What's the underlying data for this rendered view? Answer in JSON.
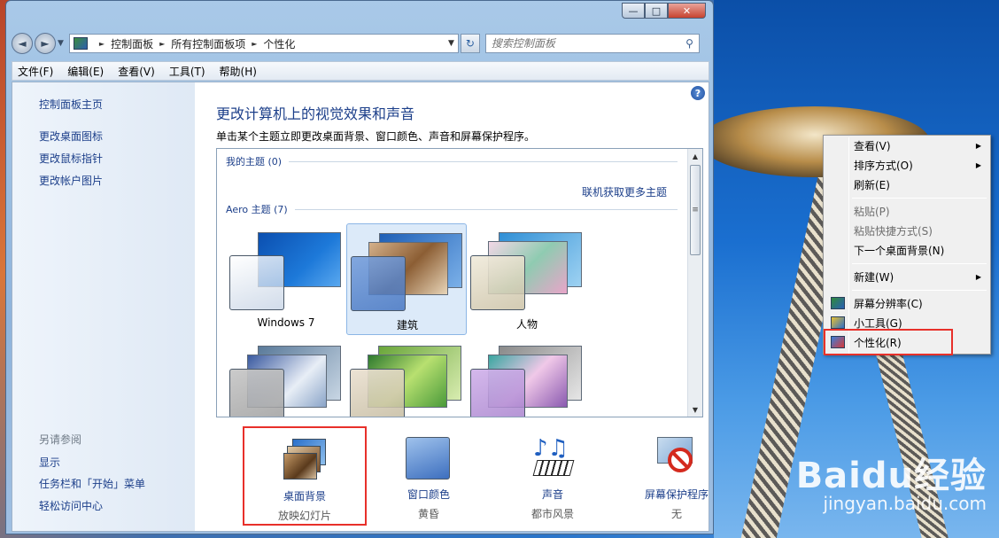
{
  "window": {
    "caption_buttons": {
      "minimize": "—",
      "maximize": "□",
      "close": "✕"
    }
  },
  "navigation": {
    "back": "◄",
    "forward": "►",
    "breadcrumbs": [
      "控制面板",
      "所有控制面板项",
      "个性化"
    ],
    "refresh": "↻",
    "search_placeholder": "搜索控制面板"
  },
  "menubar": [
    "文件(F)",
    "编辑(E)",
    "查看(V)",
    "工具(T)",
    "帮助(H)"
  ],
  "sidebar": {
    "links": [
      "控制面板主页",
      "更改桌面图标",
      "更改鼠标指针",
      "更改帐户图片"
    ],
    "see_also_heading": "另请参阅",
    "see_also": [
      "显示",
      "任务栏和「开始」菜单",
      "轻松访问中心"
    ]
  },
  "main": {
    "help": "?",
    "title": "更改计算机上的视觉效果和声音",
    "description": "单击某个主题立即更改桌面背景、窗口颜色、声音和屏幕保护程序。",
    "my_themes_heading": "我的主题 (0)",
    "more_themes_link": "联机获取更多主题",
    "aero_heading": "Aero 主题 (7)",
    "themes": [
      {
        "label": "Windows 7",
        "selected": false
      },
      {
        "label": "建筑",
        "selected": true
      },
      {
        "label": "人物",
        "selected": false
      },
      {
        "label": "",
        "selected": false
      },
      {
        "label": "",
        "selected": false
      },
      {
        "label": "",
        "selected": false
      }
    ],
    "tools": [
      {
        "label": "桌面背景",
        "sub": "放映幻灯片",
        "icon": "desktop-background-icon"
      },
      {
        "label": "窗口颜色",
        "sub": "黄昏",
        "icon": "window-color-icon"
      },
      {
        "label": "声音",
        "sub": "都市风景",
        "icon": "sound-icon"
      },
      {
        "label": "屏幕保护程序",
        "sub": "无",
        "icon": "screensaver-icon"
      }
    ]
  },
  "context_menu": [
    {
      "label": "查看(V)",
      "submenu": true,
      "disabled": false
    },
    {
      "label": "排序方式(O)",
      "submenu": true,
      "disabled": false
    },
    {
      "label": "刷新(E)",
      "submenu": false,
      "disabled": false
    },
    {
      "label": "粘贴(P)",
      "submenu": false,
      "disabled": true
    },
    {
      "label": "粘贴快捷方式(S)",
      "submenu": false,
      "disabled": true
    },
    {
      "label": "下一个桌面背景(N)",
      "submenu": false,
      "disabled": false
    },
    {
      "label": "新建(W)",
      "submenu": true,
      "disabled": false
    },
    {
      "label": "屏幕分辨率(C)",
      "submenu": false,
      "disabled": false
    },
    {
      "label": "小工具(G)",
      "submenu": false,
      "disabled": false
    },
    {
      "label": "个性化(R)",
      "submenu": false,
      "disabled": false
    }
  ],
  "watermark": {
    "logo": "Baidu经验",
    "url": "jingyan.baidu.com"
  },
  "colors": {
    "link": "#1c3f8a",
    "highlight_border": "#e8302a",
    "selected_theme": "#dceaf9"
  }
}
